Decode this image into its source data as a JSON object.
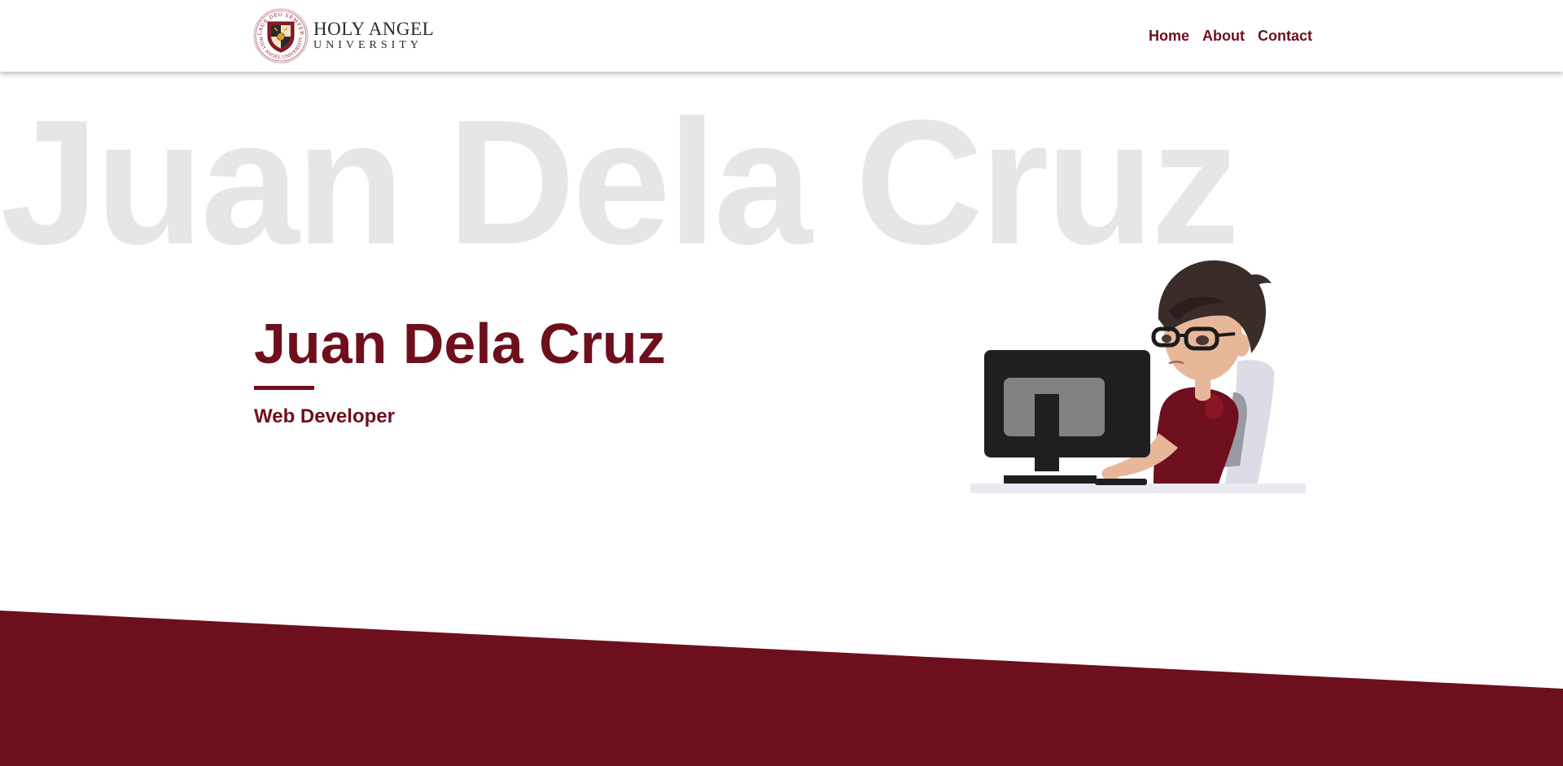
{
  "header": {
    "logo": {
      "line1": "HOLY ANGEL",
      "line2": "UNIVERSITY",
      "seal_text_top": "LAUS DEO SEMPER",
      "seal_text_bottom": "HOLY ANGEL UNIVERSITY"
    },
    "nav": [
      {
        "label": "Home"
      },
      {
        "label": "About"
      },
      {
        "label": "Contact"
      }
    ]
  },
  "hero": {
    "background_name": "Juan Dela Cruz",
    "name": "Juan Dela Cruz",
    "role": "Web Developer",
    "illustration_icon": "developer-at-computer-illustration"
  },
  "colors": {
    "brand": "#6e0f1e",
    "background_text": "#e6e6e6",
    "background": "#ffffff"
  }
}
